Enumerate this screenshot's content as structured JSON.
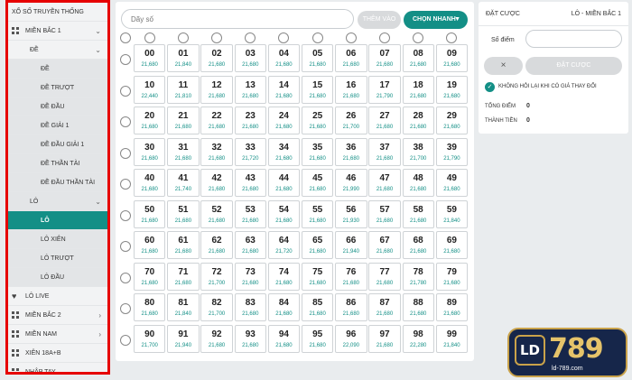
{
  "sidebar": {
    "items": [
      {
        "label": "Xổ số truyền thống",
        "level": "l1",
        "icon": "",
        "chevron": ""
      },
      {
        "label": "Miền Bắc 1",
        "level": "l1",
        "icon": "grid-icon",
        "chevron": "⌄"
      },
      {
        "label": "Đề",
        "level": "l2",
        "icon": "",
        "chevron": "⌄"
      },
      {
        "label": "Đề",
        "level": "l3",
        "icon": "",
        "chevron": ""
      },
      {
        "label": "Đề trượt",
        "level": "l3",
        "icon": "",
        "chevron": ""
      },
      {
        "label": "Đề đầu",
        "level": "l3",
        "icon": "",
        "chevron": ""
      },
      {
        "label": "Đề giải 1",
        "level": "l3",
        "icon": "",
        "chevron": ""
      },
      {
        "label": "Đề đầu giải 1",
        "level": "l3",
        "icon": "",
        "chevron": ""
      },
      {
        "label": "Đề thần tài",
        "level": "l3",
        "icon": "",
        "chevron": ""
      },
      {
        "label": "Đề đầu thần tài",
        "level": "l3",
        "icon": "",
        "chevron": ""
      },
      {
        "label": "Lô",
        "level": "l2 sub",
        "icon": "",
        "chevron": "⌄"
      },
      {
        "label": "Lô",
        "level": "l3 active",
        "icon": "",
        "chevron": ""
      },
      {
        "label": "Lô xiên",
        "level": "l3",
        "icon": "",
        "chevron": ""
      },
      {
        "label": "Lô trượt",
        "level": "l3",
        "icon": "",
        "chevron": ""
      },
      {
        "label": "Lô đầu",
        "level": "l3",
        "icon": "",
        "chevron": ""
      },
      {
        "label": "Lô live",
        "level": "l1",
        "icon": "heart-icon",
        "chevron": ""
      },
      {
        "label": "Miền Bắc 2",
        "level": "l1",
        "icon": "grid-icon",
        "chevron": "›"
      },
      {
        "label": "Miền Nam",
        "level": "l1",
        "icon": "grid-icon",
        "chevron": "›"
      },
      {
        "label": "Xiên 18A+B",
        "level": "l1",
        "icon": "grid-icon",
        "chevron": ""
      },
      {
        "label": "Nhập tay",
        "level": "l1",
        "icon": "grid-icon",
        "chevron": ""
      }
    ]
  },
  "toolbar": {
    "search_placeholder": "Dãy số",
    "add_label": "THÊM VÀO",
    "quick_label": "Chọn nhanh"
  },
  "grid": {
    "numbers": [
      "00",
      "01",
      "02",
      "03",
      "04",
      "05",
      "06",
      "07",
      "08",
      "09",
      "10",
      "11",
      "12",
      "13",
      "14",
      "15",
      "16",
      "17",
      "18",
      "19",
      "20",
      "21",
      "22",
      "23",
      "24",
      "25",
      "26",
      "27",
      "28",
      "29",
      "30",
      "31",
      "32",
      "33",
      "34",
      "35",
      "36",
      "37",
      "38",
      "39",
      "40",
      "41",
      "42",
      "43",
      "44",
      "45",
      "46",
      "47",
      "48",
      "49",
      "50",
      "51",
      "52",
      "53",
      "54",
      "55",
      "56",
      "57",
      "58",
      "59",
      "60",
      "61",
      "62",
      "63",
      "64",
      "65",
      "66",
      "67",
      "68",
      "69",
      "70",
      "71",
      "72",
      "73",
      "74",
      "75",
      "76",
      "77",
      "78",
      "79",
      "80",
      "81",
      "82",
      "83",
      "84",
      "85",
      "86",
      "87",
      "88",
      "89",
      "90",
      "91",
      "92",
      "93",
      "94",
      "95",
      "96",
      "97",
      "98",
      "99"
    ],
    "odds": [
      "21,680",
      "21,840",
      "21,680",
      "21,680",
      "21,680",
      "21,680",
      "21,680",
      "21,680",
      "21,680",
      "21,680",
      "22,440",
      "21,810",
      "21,680",
      "21,680",
      "21,680",
      "21,680",
      "21,680",
      "21,790",
      "21,680",
      "21,680",
      "21,680",
      "21,680",
      "21,680",
      "21,680",
      "21,680",
      "21,680",
      "21,700",
      "21,680",
      "21,680",
      "21,680",
      "21,680",
      "21,680",
      "21,680",
      "21,720",
      "21,680",
      "21,680",
      "21,680",
      "21,680",
      "21,700",
      "21,790",
      "21,680",
      "21,740",
      "21,680",
      "21,680",
      "21,680",
      "21,680",
      "21,990",
      "21,680",
      "21,680",
      "21,680",
      "21,680",
      "21,680",
      "21,680",
      "21,680",
      "21,680",
      "21,680",
      "21,930",
      "21,680",
      "21,680",
      "21,840",
      "21,680",
      "21,680",
      "21,680",
      "21,680",
      "21,720",
      "21,680",
      "21,940",
      "21,680",
      "21,680",
      "21,680",
      "21,680",
      "21,680",
      "21,700",
      "21,680",
      "21,680",
      "21,680",
      "21,680",
      "21,680",
      "21,780",
      "21,680",
      "21,680",
      "21,840",
      "21,700",
      "21,680",
      "21,680",
      "21,680",
      "21,680",
      "21,680",
      "21,680",
      "21,680",
      "21,700",
      "21,940",
      "21,680",
      "21,680",
      "21,680",
      "21,680",
      "22,090",
      "21,680",
      "22,280",
      "21,840"
    ]
  },
  "bet_panel": {
    "title": "Đặt cược",
    "game": "Lô - Miền Bắc 1",
    "amount_label": "Số điểm",
    "clear_icon": "×",
    "bet_label": "Đặt cược",
    "confirm_label": "Không hỏi lại khi có giá thay đổi",
    "total_points_label": "Tổng điểm",
    "total_points_value": "0",
    "total_money_label": "Thành tiền",
    "total_money_value": "0"
  },
  "logo": {
    "badge": "LD",
    "text": "789",
    "url": "ld-789.com"
  },
  "colors": {
    "accent": "#138f86",
    "highlight_border": "#e60000"
  }
}
